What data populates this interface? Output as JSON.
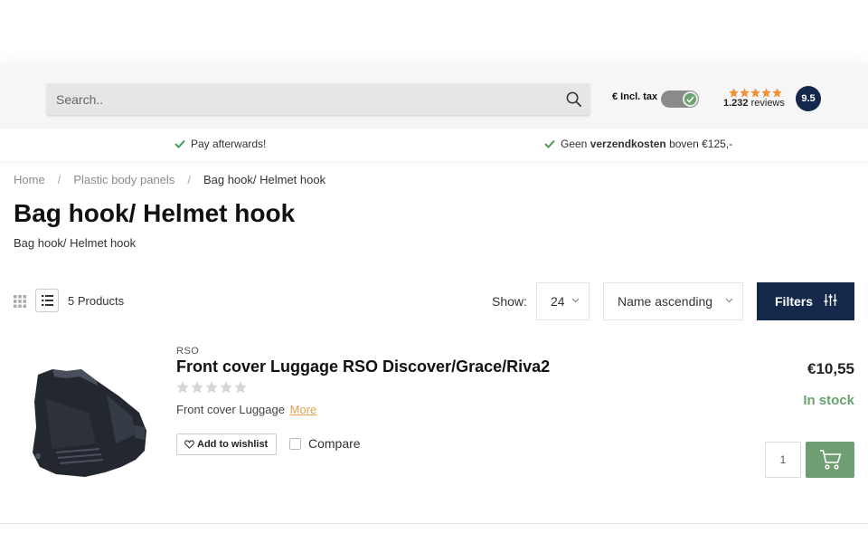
{
  "header": {
    "search_placeholder": "Search..",
    "tax_label": "€ Incl. tax",
    "tax_toggle_on": true,
    "reviews_count": "1.232",
    "reviews_label": "reviews",
    "rating_stars": 5,
    "score": "9.5"
  },
  "usp": [
    {
      "text": "Pay afterwards!"
    },
    {
      "prefix": "Geen ",
      "bold": "verzendkosten",
      "suffix": " boven €125,-"
    }
  ],
  "breadcrumb": [
    {
      "label": "Home"
    },
    {
      "label": "Plastic body panels"
    },
    {
      "label": "Bag hook/ Helmet hook"
    }
  ],
  "page": {
    "title": "Bag hook/ Helmet hook",
    "subtitle": "Bag hook/ Helmet hook"
  },
  "toolbar": {
    "product_count": "5 Products",
    "show_label": "Show:",
    "show_value": "24",
    "sort_value": "Name ascending",
    "filters_label": "Filters"
  },
  "product": {
    "brand": "RSO",
    "title": "Front cover Luggage RSO Discover/Grace/Riva2",
    "rating": 0,
    "description": "Front cover Luggage",
    "more_label": "More",
    "wishlist_label": "Add to wishlist",
    "compare_label": "Compare",
    "price": "€10,55",
    "stock": "In stock",
    "quantity": "1"
  },
  "colors": {
    "navy": "#14284b",
    "green": "#6aa36f",
    "accent_orange": "#e0a050",
    "star_orange": "#f0923a"
  }
}
